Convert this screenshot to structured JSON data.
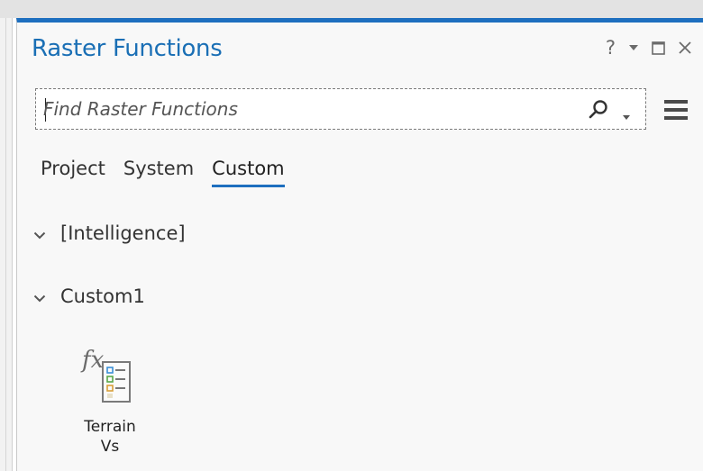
{
  "pane": {
    "title": "Raster Functions",
    "help_label": "?"
  },
  "search": {
    "placeholder": "Find Raster Functions",
    "value": ""
  },
  "tabs": [
    {
      "label": "Project",
      "active": false
    },
    {
      "label": "System",
      "active": false
    },
    {
      "label": "Custom",
      "active": true
    }
  ],
  "groups": [
    {
      "label": "[Intelligence]",
      "expanded": true
    },
    {
      "label": "Custom1",
      "expanded": true
    }
  ],
  "functions": [
    {
      "label_line1": "Terrain",
      "label_line2": "Vs",
      "icon": "fx-raster-function-icon"
    }
  ],
  "colors": {
    "accent": "#1e6fbf",
    "title": "#1a6fb5"
  }
}
